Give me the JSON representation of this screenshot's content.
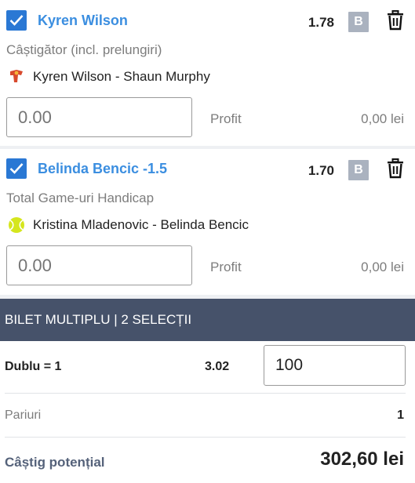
{
  "selections": [
    {
      "name": "Kyren Wilson",
      "odds": "1.78",
      "badge": "B",
      "market": "Câștigător (incl. prelungiri)",
      "event": "Kyren Wilson - Shaun Murphy",
      "event_icon": "snooker-icon",
      "stake_placeholder": "0.00",
      "profit_label": "Profit",
      "profit_value": "0,00 lei"
    },
    {
      "name": "Belinda Bencic -1.5",
      "odds": "1.70",
      "badge": "B",
      "market": "Total Game-uri Handicap",
      "event": "Kristina Mladenovic - Belinda Bencic",
      "event_icon": "tennis-ball-icon",
      "stake_placeholder": "0.00",
      "profit_label": "Profit",
      "profit_value": "0,00 lei"
    }
  ],
  "multi": {
    "header": "BILET MULTIPLU | 2 SELECȚII",
    "dublu_label": "Dublu = 1",
    "dublu_odds": "3.02",
    "dublu_stake": "100",
    "pariuri_label": "Pariuri",
    "pariuri_value": "1",
    "castig_label": "Câștig potențial",
    "castig_value": "302,60 lei"
  },
  "colors": {
    "accent": "#2a78d4",
    "selection_name": "#3b8ee0",
    "header_bg": "#46526a",
    "badge_bg": "#aab2bf"
  }
}
